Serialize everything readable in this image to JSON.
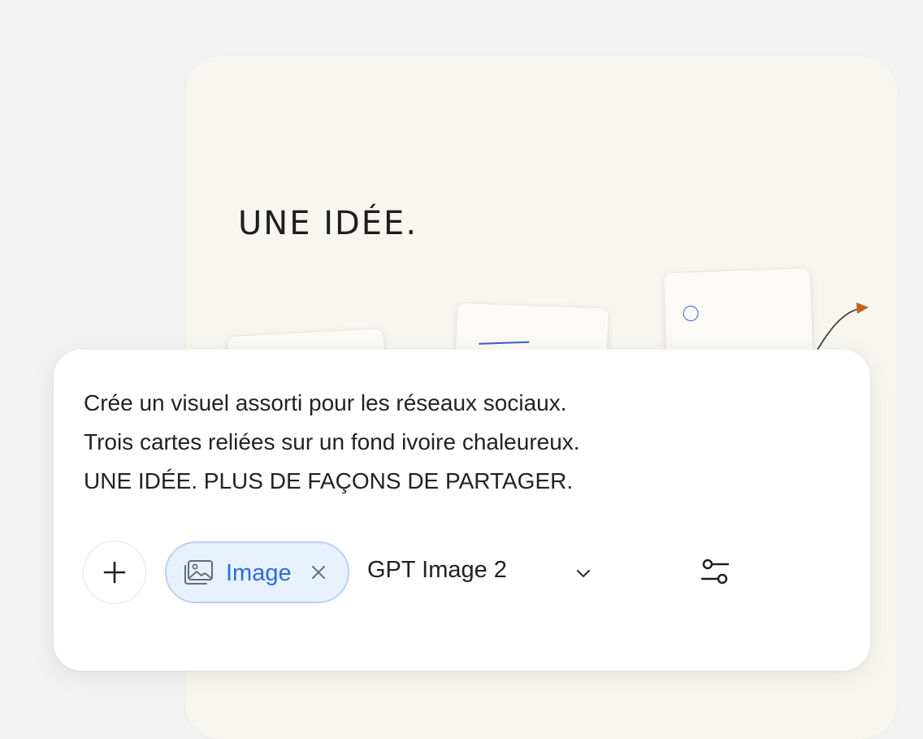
{
  "artboard": {
    "title": "UNE IDÉE.",
    "background_color": "#f8f6f1",
    "accent_color": "#3a5ec8",
    "arrow_color": "#c8601c"
  },
  "composer": {
    "prompt_lines": [
      "Crée un visuel assorti pour les réseaux sociaux.",
      "Trois cartes reliées sur un fond ivoire chaleureux.",
      "UNE IDÉE. PLUS DE FAÇONS DE PARTAGER."
    ],
    "toolbar": {
      "add_icon": "plus-icon",
      "chip": {
        "icon": "image-icon",
        "label": "Image",
        "close_icon": "close-icon",
        "background_color": "#e7f0fd",
        "text_color": "#2a6fd8"
      },
      "model": {
        "selected": "GPT Image 2",
        "icon": "chevron-down-icon"
      },
      "settings_icon": "sliders-icon"
    }
  }
}
